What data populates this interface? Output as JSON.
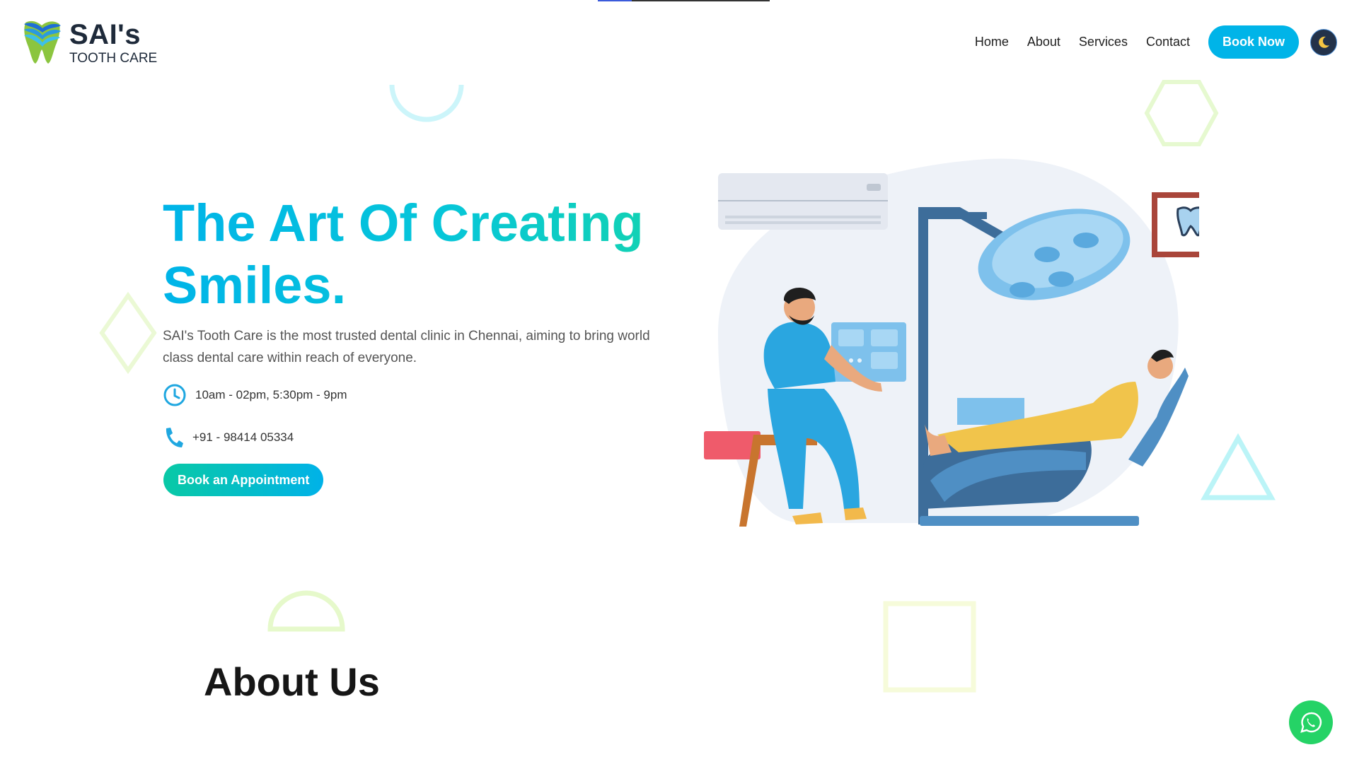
{
  "brand": {
    "name": "SAI's",
    "subtitle": "TOOTH CARE"
  },
  "nav": {
    "items": [
      "Home",
      "About",
      "Services",
      "Contact"
    ],
    "book_label": "Book Now"
  },
  "hero": {
    "title": "The Art Of Creating Smiles.",
    "description": "SAI's Tooth Care is the most trusted dental clinic in Chennai, aiming to bring world class dental care within reach of everyone.",
    "hours": "10am - 02pm, 5:30pm - 9pm",
    "phone": "+91 - 98414 05334",
    "cta_label": "Book an Appointment"
  },
  "about": {
    "heading": "About Us"
  },
  "colors": {
    "accent": "#00b4e8",
    "teal": "#13d3b0",
    "whatsapp": "#25d366",
    "dark": "#1e2a3a"
  },
  "icons": [
    "tooth-logo-icon",
    "moon-icon",
    "clock-icon",
    "phone-icon",
    "whatsapp-icon"
  ]
}
